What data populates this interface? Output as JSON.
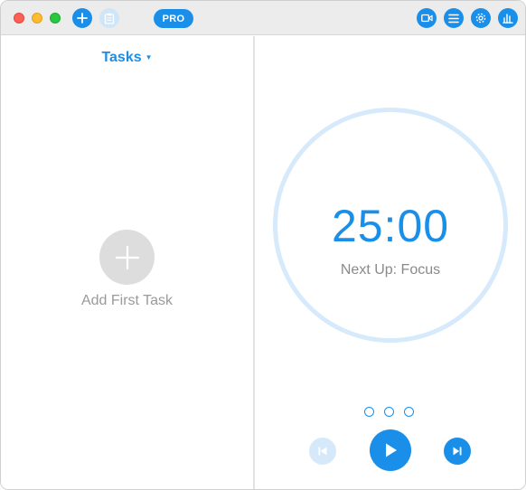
{
  "titlebar": {
    "pro_badge": "PRO",
    "icons": [
      "add-icon",
      "clipboard-icon",
      "video-icon",
      "list-icon",
      "gear-icon",
      "chart-icon"
    ]
  },
  "tasks": {
    "dropdown_label": "Tasks",
    "caret": "▼",
    "add_first_label": "Add First Task"
  },
  "timer": {
    "time": "25:00",
    "next_up": "Next Up: Focus",
    "session_dots": 3
  },
  "colors": {
    "accent": "#1a8fea",
    "accent_light": "#d7eafb",
    "muted_text": "#9a9a9a",
    "placeholder_circle": "#dddddd"
  }
}
